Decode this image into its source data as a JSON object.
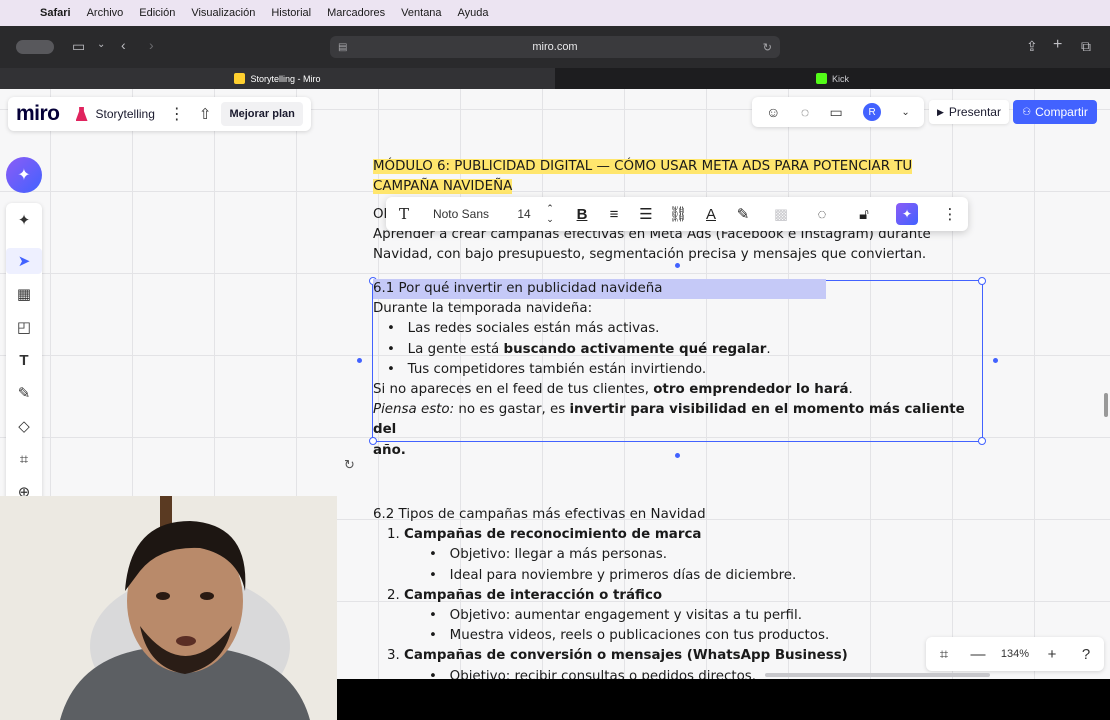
{
  "menubar": {
    "app": "Safari",
    "items": [
      "Archivo",
      "Edición",
      "Visualización",
      "Historial",
      "Marcadores",
      "Ventana",
      "Ayuda"
    ]
  },
  "browser": {
    "url": "miro.com",
    "tabs": [
      {
        "label": "Storytelling - Miro",
        "active": true
      },
      {
        "label": "Kick",
        "active": false
      }
    ]
  },
  "miro": {
    "logo": "miro",
    "board_name": "Storytelling",
    "upgrade_label": "Mejorar plan",
    "avatar_initial": "R",
    "present_label": "Presentar",
    "share_label": "Compartir",
    "zoom": "134%",
    "accent": "#4262ff"
  },
  "context_toolbar": {
    "font": "Noto Sans",
    "size": "14"
  },
  "doc": {
    "module_title_1": "MÓDULO 6: PUBLICIDAD DIGITAL — CÓMO USAR META ADS PARA POTENCIAR TU",
    "module_title_2": "CAMPAÑA NAVIDEÑA",
    "objective_prefix": "Ol",
    "objective_1": "Aprender a crear campañas efectivas en Meta Ads (Facebook e Instagram) durante",
    "objective_2": "Navidad, con bajo presupuesto, segmentación precisa y mensajes que conviertan.",
    "s61_title": "6.1 Por qué invertir en publicidad navideña",
    "s61_intro": "Durante la temporada navideña:",
    "s61_b1": "Las redes sociales están más activas.",
    "s61_b2_pre": "La gente está ",
    "s61_b2_bold": "buscando activamente qué regalar",
    "s61_b2_post": ".",
    "s61_b3": "Tus competidores también están invirtiendo.",
    "s61_p1_pre": " Si no apareces en el feed de tus clientes, ",
    "s61_p1_bold": "otro emprendedor lo hará",
    "s61_p1_post": ".",
    "s61_p2_italic": "Piensa esto:",
    "s61_p2_mid": " no es gastar, es ",
    "s61_p2_bold_1": "invertir para visibilidad en el momento más caliente del",
    "s61_p2_bold_2": "año.",
    "s62_title": "6.2 Tipos de campañas más efectivas en Navidad",
    "c1_num": "1.",
    "c1_title": "Campañas de reconocimiento de marca",
    "c1_b1": "Objetivo: llegar a más personas.",
    "c1_b2": "Ideal para noviembre y primeros días de diciembre.",
    "c2_num": "2.",
    "c2_title": "Campañas de interacción o tráfico",
    "c2_b1": "Objetivo: aumentar engagement y visitas a tu perfil.",
    "c2_b2": "Muestra videos, reels o publicaciones con tus productos.",
    "c3_num": "3.",
    "c3_title": "Campañas de conversión o mensajes (WhatsApp Business)",
    "c3_b1": "Objetivo: recibir consultas o pedidos directos."
  }
}
